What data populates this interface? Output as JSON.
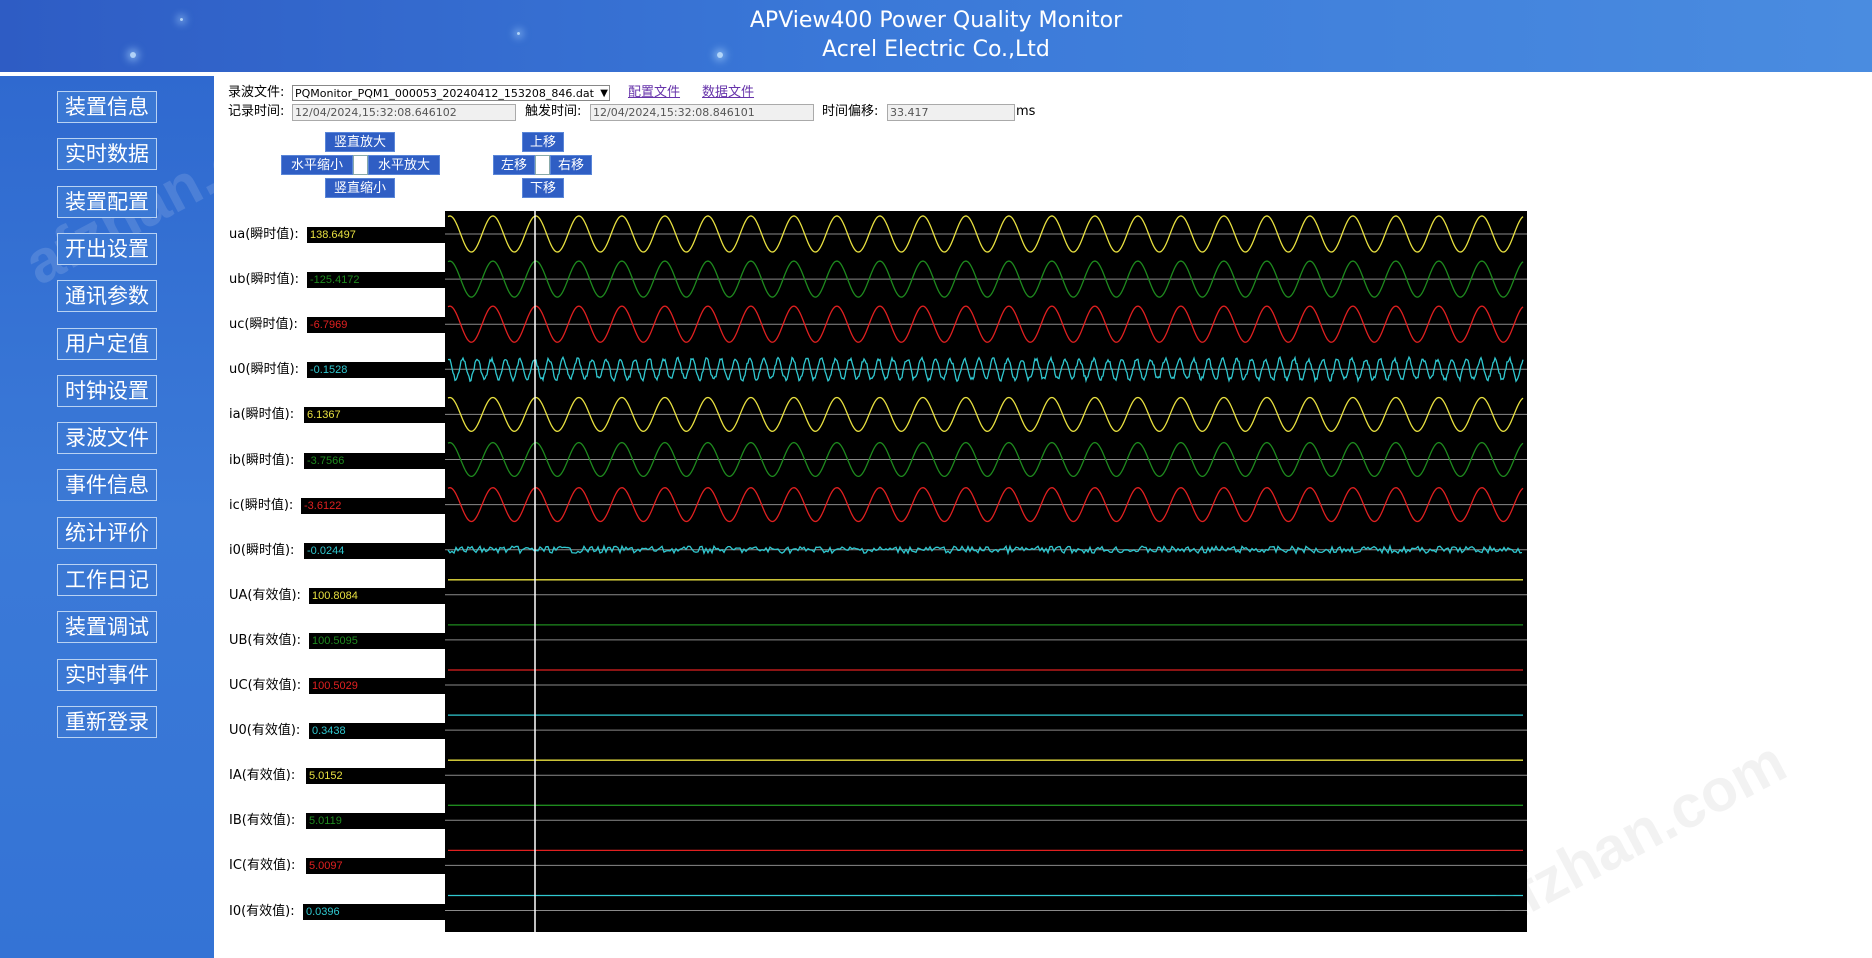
{
  "header": {
    "title": "APView400 Power Quality Monitor",
    "subtitle": "Acrel Electric Co.,Ltd"
  },
  "sidebar": {
    "items": [
      {
        "label": "装置信息"
      },
      {
        "label": "实时数据"
      },
      {
        "label": "装置配置"
      },
      {
        "label": "开出设置"
      },
      {
        "label": "通讯参数"
      },
      {
        "label": "用户定值"
      },
      {
        "label": "时钟设置"
      },
      {
        "label": "录波文件"
      },
      {
        "label": "事件信息"
      },
      {
        "label": "统计评价"
      },
      {
        "label": "工作日记"
      },
      {
        "label": "装置调试"
      },
      {
        "label": "实时事件"
      },
      {
        "label": "重新登录"
      }
    ]
  },
  "form": {
    "file_label": "录波文件:",
    "file_value": "PQMonitor_PQM1_000053_20240412_153208_846.dat",
    "config_link": "配置文件",
    "data_link": "数据文件",
    "record_time_label": "记录时间:",
    "record_time_value": "12/04/2024,15:32:08.646102",
    "trigger_time_label": "触发时间:",
    "trigger_time_value": "12/04/2024,15:32:08.846101",
    "offset_label": "时间偏移:",
    "offset_value": "33.417",
    "offset_unit": "ms"
  },
  "controls": {
    "v_zoom_in": "竖直放大",
    "h_zoom_out": "水平缩小",
    "h_zoom_in": "水平放大",
    "v_zoom_out": "竖直缩小",
    "move_up": "上移",
    "move_left": "左移",
    "move_right": "右移",
    "move_down": "下移"
  },
  "channels": [
    {
      "label": "ua(瞬时值):",
      "value": "138.6497",
      "color": "#e8e040",
      "type": "sine",
      "cycles": 25,
      "amp": 0.8
    },
    {
      "label": "ub(瞬时值):",
      "value": "-125.4172",
      "color": "#1e8a1e",
      "type": "sine",
      "cycles": 25,
      "amp": 0.8
    },
    {
      "label": "uc(瞬时值):",
      "value": "-6.7969",
      "color": "#e02020",
      "type": "sine",
      "cycles": 25,
      "amp": 0.8
    },
    {
      "label": "u0(瞬时值):",
      "value": "-0.1528",
      "color": "#30c8d0",
      "type": "sine",
      "cycles": 75,
      "amp": 0.45
    },
    {
      "label": "ia(瞬时值):",
      "value": "6.1367",
      "color": "#e8e040",
      "type": "sine",
      "cycles": 25,
      "amp": 0.75
    },
    {
      "label": "ib(瞬时值):",
      "value": "-3.7566",
      "color": "#1e8a1e",
      "type": "sine",
      "cycles": 25,
      "amp": 0.75
    },
    {
      "label": "ic(瞬时值):",
      "value": "-3.6122",
      "color": "#e02020",
      "type": "sine",
      "cycles": 25,
      "amp": 0.75
    },
    {
      "label": "i0(瞬时值):",
      "value": "-0.0244",
      "color": "#30c8d0",
      "type": "noise"
    },
    {
      "label": "UA(有效值):",
      "value": "100.8084",
      "color": "#e8e040",
      "type": "flat"
    },
    {
      "label": "UB(有效值):",
      "value": "100.5095",
      "color": "#1e8a1e",
      "type": "flat"
    },
    {
      "label": "UC(有效值):",
      "value": "100.5029",
      "color": "#e02020",
      "type": "flat"
    },
    {
      "label": "U0(有效值):",
      "value": "0.3438",
      "color": "#30c8d0",
      "type": "flat"
    },
    {
      "label": "IA(有效值):",
      "value": "5.0152",
      "color": "#e8e040",
      "type": "flat"
    },
    {
      "label": "IB(有效值):",
      "value": "5.0119",
      "color": "#1e8a1e",
      "type": "flat"
    },
    {
      "label": "IC(有效值):",
      "value": "5.0097",
      "color": "#e02020",
      "type": "flat"
    },
    {
      "label": "I0(有效值):",
      "value": "0.0396",
      "color": "#30c8d0",
      "type": "flat"
    }
  ]
}
